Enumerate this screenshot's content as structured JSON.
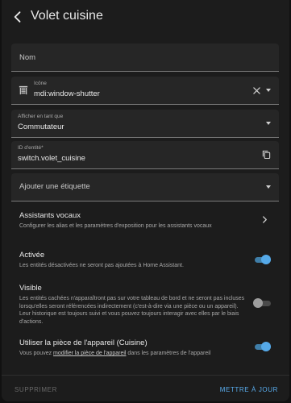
{
  "header": {
    "title": "Volet cuisine",
    "back_icon": "arrow-left-icon"
  },
  "fields": {
    "name": {
      "placeholder": "Nom"
    },
    "icon": {
      "label": "Icône",
      "value": "mdi:window-shutter",
      "icon": "window-shutter-icon"
    },
    "show_as": {
      "label": "Afficher en tant que",
      "value": "Commutateur"
    },
    "entity_id": {
      "label": "ID d'entité*",
      "value": "switch.volet_cuisine"
    },
    "label": {
      "placeholder": "Ajouter une étiquette"
    }
  },
  "voice": {
    "title": "Assistants vocaux",
    "description": "Configurer les alias et les paramètres d'exposition pour les assistants vocaux"
  },
  "enabled": {
    "title": "Activée",
    "description": "Les entités désactivées ne seront pas ajoutées à Home Assistant.",
    "state": true
  },
  "visible": {
    "title": "Visible",
    "description": "Les entités cachées n'apparaîtront pas sur votre tableau de bord et ne seront pas incluses lorsqu'elles seront référencées indirectement (c'est-à-dire via une pièce ou un appareil). Leur historique est toujours suivi et vous pouvez toujours interagir avec elles par le biais d'actions.",
    "state": false
  },
  "area": {
    "title": "Utiliser la pièce de l'appareil (Cuisine)",
    "desc_before": "Vous pouvez ",
    "desc_link": "modifier la pièce de l'appareil",
    "desc_after": " dans les paramètres de l'appareil",
    "state": true
  },
  "footer": {
    "delete_label": "SUPPRIMER",
    "update_label": "METTRE À JOUR"
  },
  "colors": {
    "accent": "#55a9e8",
    "background": "#1c1c1c",
    "field": "#262626"
  }
}
